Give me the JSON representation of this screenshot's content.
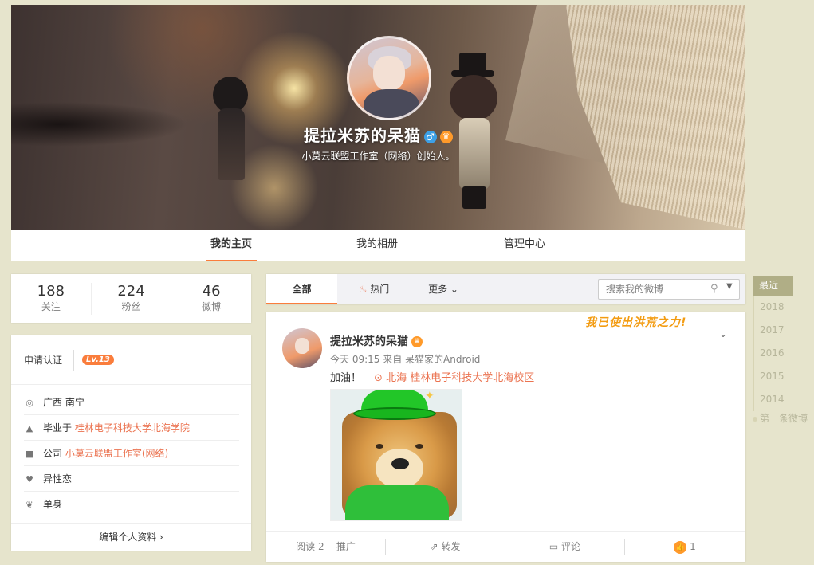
{
  "profile": {
    "name": "提拉米苏的呆猫",
    "gender_icon": "♂",
    "verified_icon": "crown-icon",
    "description": "小莫云联盟工作室（网络）创始人。"
  },
  "nav": {
    "tabs": [
      {
        "label": "我的主页",
        "active": true
      },
      {
        "label": "我的相册",
        "active": false
      },
      {
        "label": "管理中心",
        "active": false
      }
    ]
  },
  "stats": [
    {
      "number": "188",
      "label": "关注"
    },
    {
      "number": "224",
      "label": "粉丝"
    },
    {
      "number": "46",
      "label": "微博"
    }
  ],
  "info": {
    "apply": "申请认证",
    "level": "Lv.13",
    "rows": [
      {
        "icon": "location-icon",
        "text": "广西 南宁",
        "link": ""
      },
      {
        "icon": "graduation-cap-icon",
        "text": "毕业于 ",
        "link": "桂林电子科技大学北海学院"
      },
      {
        "icon": "briefcase-icon",
        "text": "公司 ",
        "link": "小莫云联盟工作室(网络)"
      },
      {
        "icon": "heart-icon",
        "text": "异性恋",
        "link": ""
      },
      {
        "icon": "hearts-icon",
        "text": "单身",
        "link": ""
      }
    ],
    "edit": "编辑个人资料 ›"
  },
  "feed_tabs": {
    "all": "全部",
    "hot": "热门",
    "more": "更多 ⌄",
    "search_placeholder": "搜索我的微博"
  },
  "post": {
    "author": "提拉米苏的呆猫",
    "meta": "今天 09:15 来自 呆猫家的Android",
    "text": "加油！",
    "location": "北海 桂林电子科技大学北海校区",
    "sticker_text": "我已使出洪荒之力!",
    "actions": {
      "read": "阅读 2",
      "promote": "推广",
      "repost": "转发",
      "comment": "评论",
      "likes": "1"
    }
  },
  "timeline": {
    "current": "最近",
    "years": [
      "2018",
      "2017",
      "2016",
      "2015",
      "2014"
    ],
    "first": "第一条微博"
  },
  "colors": {
    "accent": "#fa7d3c",
    "link": "#eb7350",
    "page_bg": "#e6e4cc",
    "timeline_active": "#b0ae86"
  }
}
